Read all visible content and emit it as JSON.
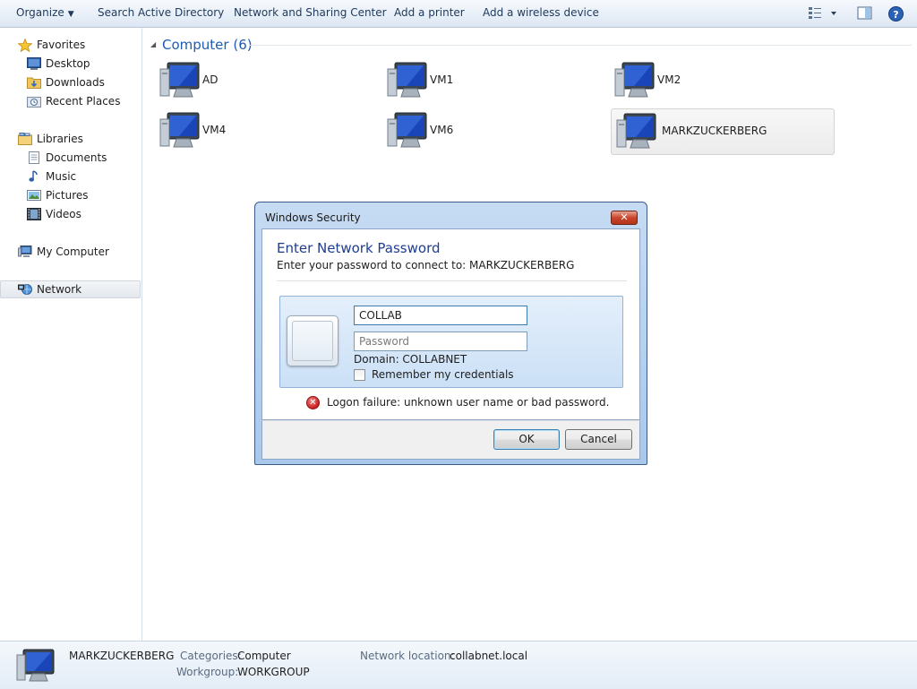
{
  "toolbar": {
    "organize": "Organize",
    "search_ad": "Search Active Directory",
    "network_sharing": "Network and Sharing Center",
    "add_printer": "Add a printer",
    "add_wireless": "Add a wireless device",
    "icons": [
      "view-options-icon",
      "preview-pane-icon",
      "help-icon"
    ]
  },
  "nav": {
    "favorites": "Favorites",
    "desktop": "Desktop",
    "downloads": "Downloads",
    "recent": "Recent Places",
    "libraries": "Libraries",
    "documents": "Documents",
    "music": "Music",
    "pictures": "Pictures",
    "videos": "Videos",
    "my_computer": "My Computer",
    "network": "Network",
    "selected": "Network"
  },
  "main": {
    "group_title": "Computer (6)",
    "computers": [
      "AD",
      "VM1",
      "VM2",
      "VM4",
      "VM6",
      "MARKZUCKERBERG"
    ],
    "selected": "MARKZUCKERBERG"
  },
  "dialog": {
    "title": "Windows Security",
    "heading": "Enter Network Password",
    "subtitle": "Enter your password to connect to: MARKZUCKERBERG",
    "username_value": "COLLAB",
    "password_placeholder": "Password",
    "domain": "Domain: COLLABNET",
    "remember": "Remember my credentials",
    "remember_checked": false,
    "error": "Logon failure: unknown user name or bad password.",
    "ok": "OK",
    "cancel": "Cancel",
    "close_glyph": "✕",
    "error_glyph": "✕"
  },
  "details": {
    "name": "MARKZUCKERBERG",
    "categories_label": "Categories:",
    "categories_value": "Computer",
    "workgroup_label": "Workgroup:",
    "workgroup_value": "WORKGROUP",
    "location_label": "Network location:",
    "location_value": "collabnet.local"
  },
  "colors": {
    "accent": "#1e5cb3",
    "toolbar_text": "#1e395b",
    "error": "#c91e1e",
    "dialog_frame": "#aac8ea"
  }
}
